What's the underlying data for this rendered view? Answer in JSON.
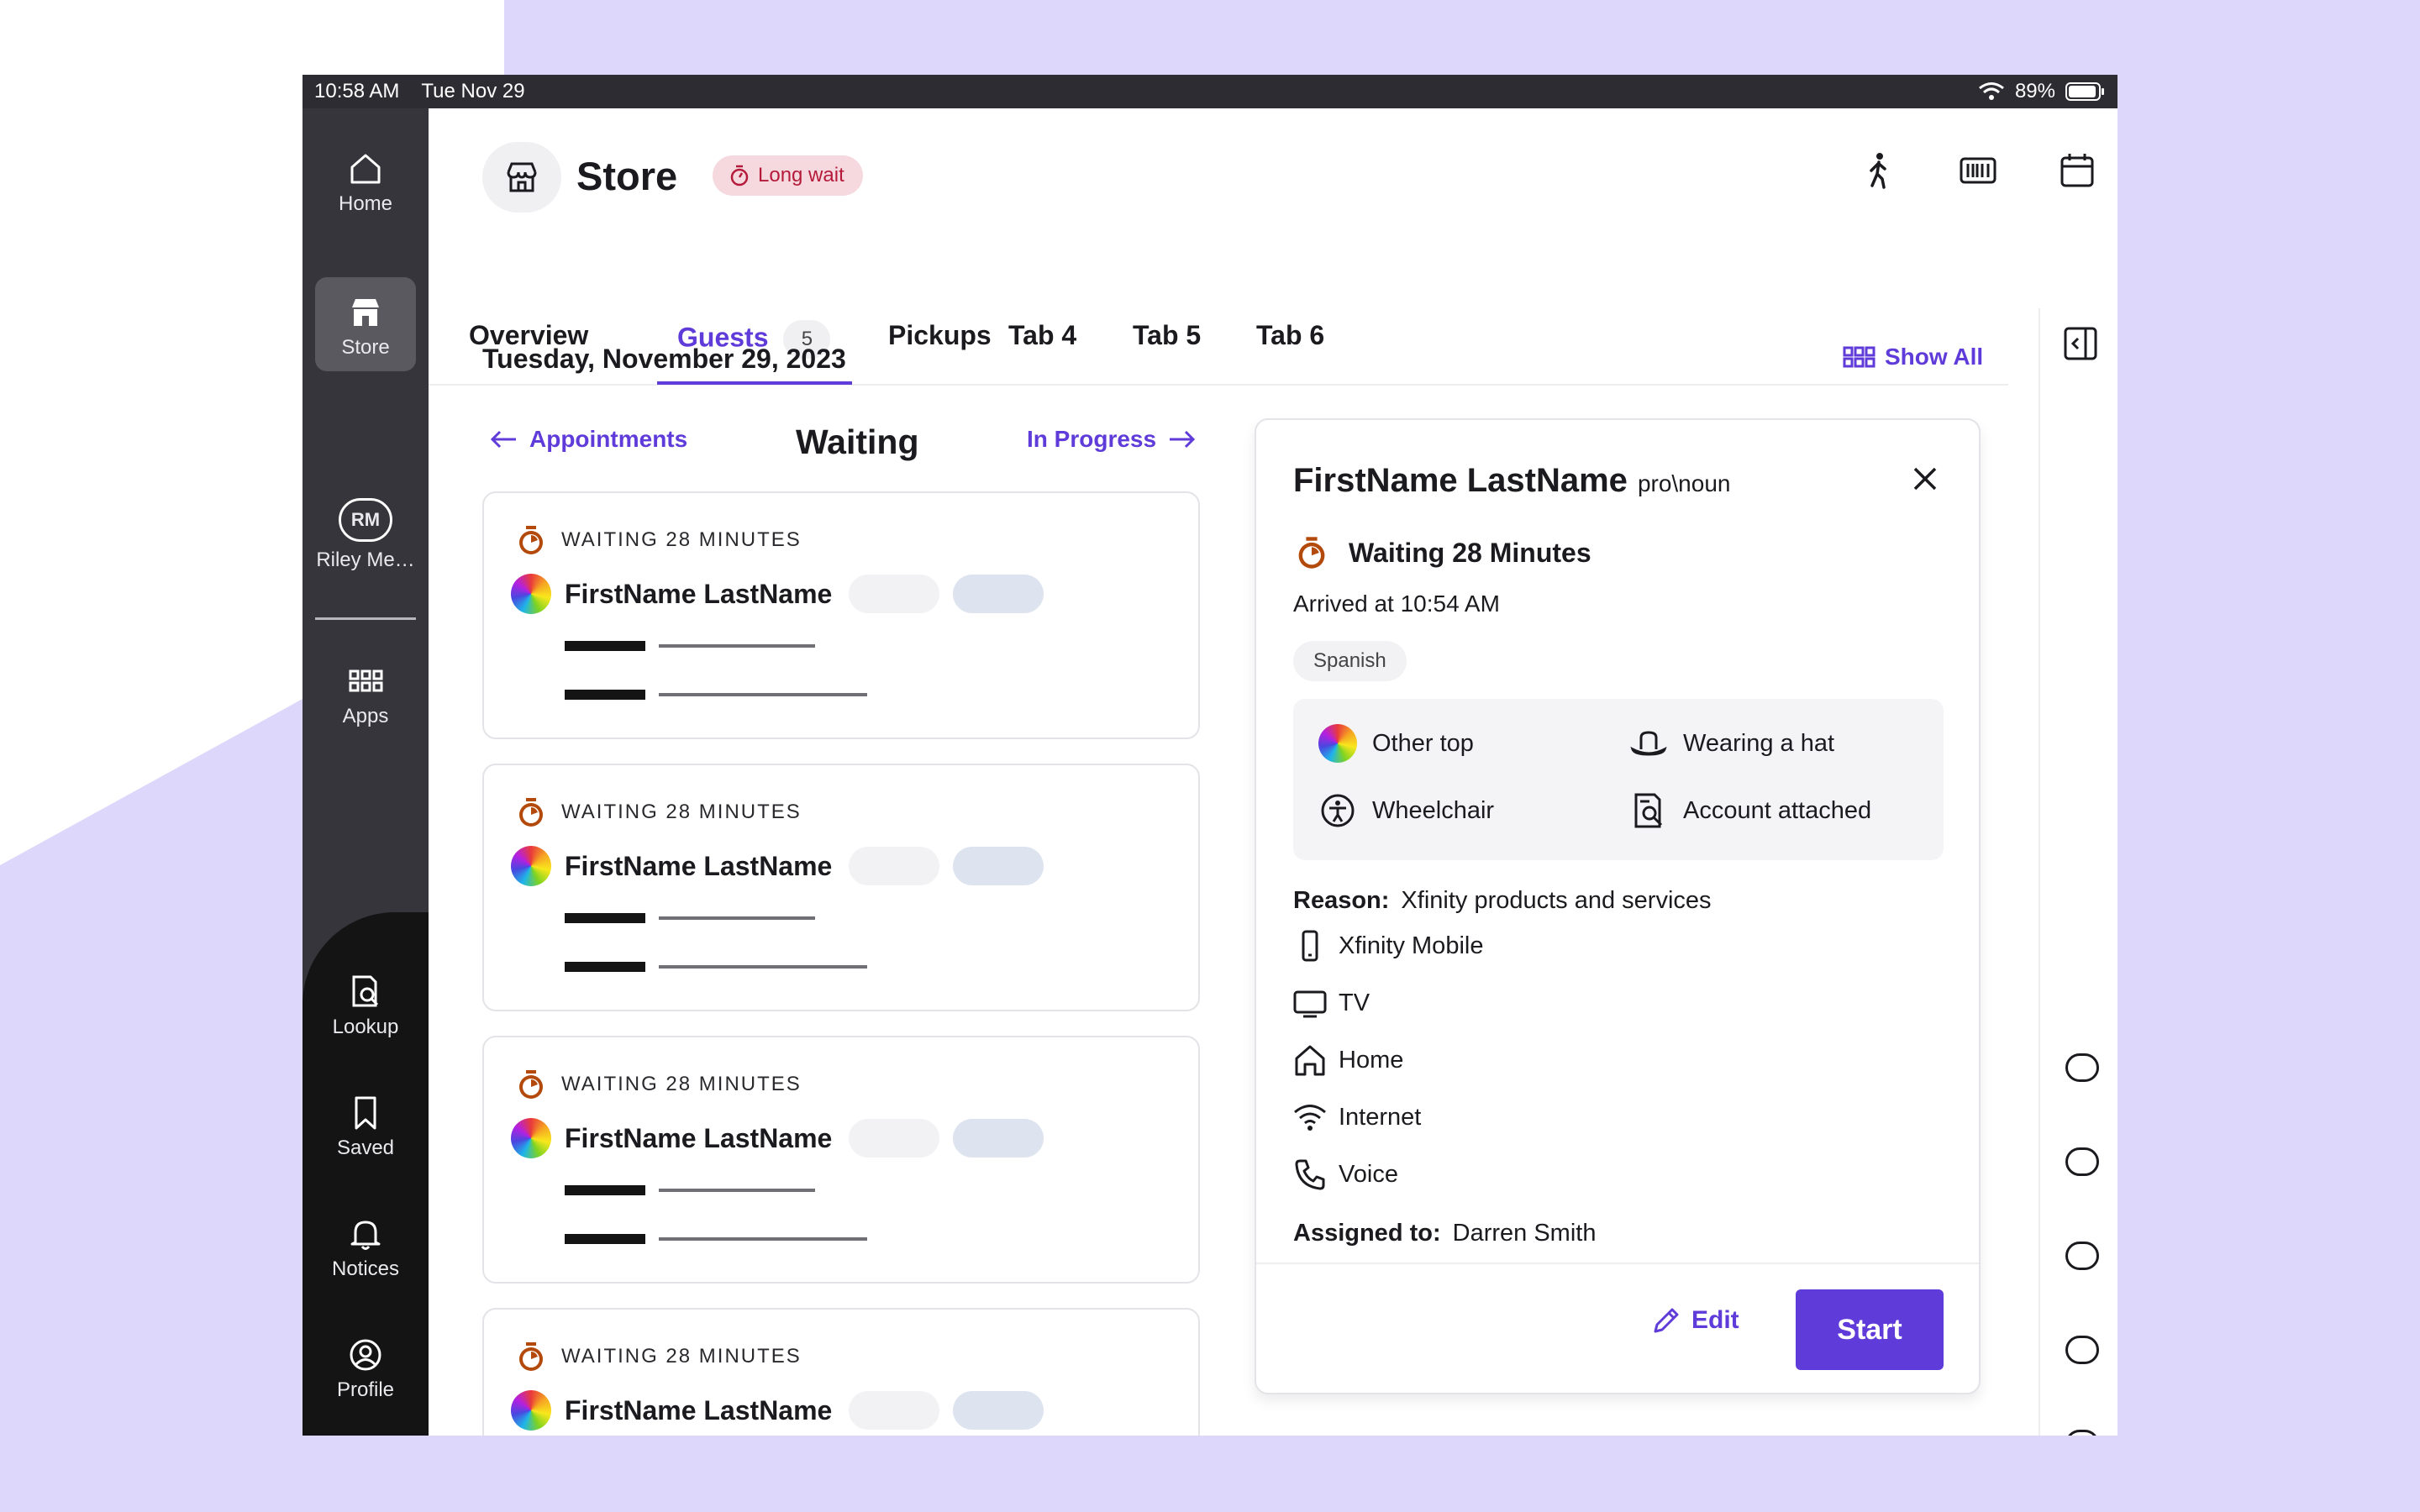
{
  "colors": {
    "accent": "#5f3bd9",
    "long_wait_bg": "#f6d9de",
    "long_wait_text": "#b51a3a",
    "timer": "#b34a0c"
  },
  "status_bar": {
    "time": "10:58 AM",
    "date": "Tue Nov 29",
    "battery": "89%"
  },
  "sidebar": {
    "items": [
      {
        "label": "Home",
        "icon": "home-icon"
      },
      {
        "label": "Store",
        "icon": "store-icon"
      },
      {
        "initials": "RM",
        "label": "Riley Me…"
      },
      {
        "label": "Apps",
        "icon": "grid-icon"
      }
    ],
    "bottom_items": [
      {
        "label": "Lookup",
        "icon": "lookup-icon"
      },
      {
        "label": "Saved",
        "icon": "bookmark-icon"
      },
      {
        "label": "Notices",
        "icon": "bell-icon"
      },
      {
        "label": "Profile",
        "icon": "profile-icon"
      }
    ]
  },
  "header": {
    "title": "Store",
    "badge": "Long wait",
    "actions": [
      "walk-in-icon",
      "barcode-icon",
      "calendar-icon"
    ]
  },
  "tabs": [
    {
      "label": "Overview"
    },
    {
      "label": "Guests",
      "count": "5"
    },
    {
      "label": "Pickups"
    },
    {
      "label": "Tab 4"
    },
    {
      "label": "Tab 5"
    },
    {
      "label": "Tab 6"
    }
  ],
  "main": {
    "date": "Tuesday, November 29, 2023",
    "show_all": "Show All",
    "prev_column": "Appointments",
    "column_title": "Waiting",
    "next_column": "In Progress",
    "cards": [
      {
        "status": "WAITING 28 MINUTES",
        "name": "FirstName LastName"
      },
      {
        "status": "WAITING 28 MINUTES",
        "name": "FirstName LastName"
      },
      {
        "status": "WAITING 28 MINUTES",
        "name": "FirstName LastName"
      },
      {
        "status": "WAITING 28 MINUTES",
        "name": "FirstName LastName"
      }
    ]
  },
  "detail": {
    "name": "FirstName LastName",
    "pronoun": "pro\\noun",
    "wait": "Waiting 28 Minutes",
    "arrived": "Arrived at 10:54 AM",
    "language": "Spanish",
    "attributes": [
      {
        "label": "Other top",
        "icon": "rainbow-swatch-icon"
      },
      {
        "label": "Wearing a hat",
        "icon": "hat-icon"
      },
      {
        "label": "Wheelchair",
        "icon": "accessibility-icon"
      },
      {
        "label": "Account attached",
        "icon": "account-search-icon"
      }
    ],
    "reason_label": "Reason:",
    "reason_value": "Xfinity products and services",
    "services": [
      {
        "label": "Xfinity Mobile",
        "icon": "mobile-icon"
      },
      {
        "label": "TV",
        "icon": "tv-icon"
      },
      {
        "label": "Home",
        "icon": "home-icon"
      },
      {
        "label": "Internet",
        "icon": "wifi-icon"
      },
      {
        "label": "Voice",
        "icon": "phone-icon"
      }
    ],
    "assigned_label": "Assigned to:",
    "assigned_value": "Darren Smith",
    "edit_label": "Edit",
    "start_label": "Start"
  }
}
